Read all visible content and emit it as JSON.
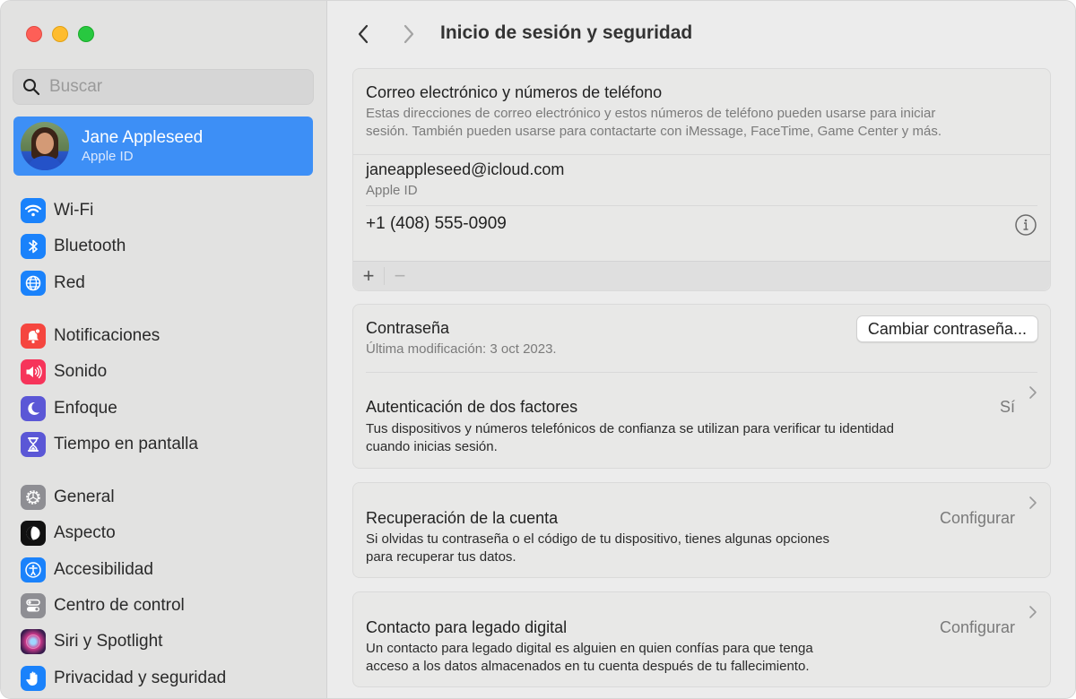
{
  "window": {
    "traffic_lights": [
      "close",
      "minimize",
      "zoom"
    ]
  },
  "sidebar": {
    "search": {
      "placeholder": "Buscar",
      "value": ""
    },
    "account": {
      "name": "Jane Appleseed",
      "subtitle": "Apple ID",
      "selected": true
    },
    "groups": [
      [
        {
          "label": "Wi-Fi",
          "icon": "wifi-icon",
          "color": "#1a82fb"
        },
        {
          "label": "Bluetooth",
          "icon": "bluetooth-icon",
          "color": "#1a82fb"
        },
        {
          "label": "Red",
          "icon": "globe-icon",
          "color": "#1a82fb"
        }
      ],
      [
        {
          "label": "Notificaciones",
          "icon": "bell-icon",
          "color": "#f5463f"
        },
        {
          "label": "Sonido",
          "icon": "speaker-icon",
          "color": "#f6345a"
        },
        {
          "label": "Enfoque",
          "icon": "moon-icon",
          "color": "#5b57d6"
        },
        {
          "label": "Tiempo en pantalla",
          "icon": "hourglass-icon",
          "color": "#5b57d6"
        }
      ],
      [
        {
          "label": "General",
          "icon": "gear-icon",
          "color": "#8e8e93"
        },
        {
          "label": "Aspecto",
          "icon": "appearance-icon",
          "color": "#111111"
        },
        {
          "label": "Accesibilidad",
          "icon": "accessibility-icon",
          "color": "#1a82fb"
        },
        {
          "label": "Centro de control",
          "icon": "toggles-icon",
          "color": "#8e8e93"
        },
        {
          "label": "Siri y Spotlight",
          "icon": "siri-icon",
          "color": "#3a1d4e"
        },
        {
          "label": "Privacidad y seguridad",
          "icon": "hand-icon",
          "color": "#1a82fb"
        }
      ]
    ]
  },
  "main": {
    "title": "Inicio de sesión y seguridad",
    "email_section": {
      "title": "Correo electrónico y números de teléfono",
      "description_line1": "Estas direcciones de correo electrónico y estos números de teléfono pueden usarse para iniciar",
      "description_line2": "sesión. También pueden usarse para contactarte con iMessage, FaceTime, Game Center y más.",
      "entries": [
        {
          "value": "janeappleseed@icloud.com",
          "label": "Apple ID"
        },
        {
          "value": "+1 (408) 555-0909",
          "label": ""
        }
      ],
      "add_label": "+",
      "remove_label": "−"
    },
    "password_section": {
      "title": "Contraseña",
      "subtitle": "Última modificación: 3 oct 2023.",
      "button": "Cambiar contraseña..."
    },
    "two_factor": {
      "title": "Autenticación de dos factores",
      "value": "Sí",
      "description_line1": "Tus dispositivos y números telefónicos de confianza se utilizan para verificar tu identidad",
      "description_line2": "cuando inicias sesión."
    },
    "account_recovery": {
      "title": "Recuperación de la cuenta",
      "value": "Configurar",
      "description_line1": "Si olvidas tu contraseña o el código de tu dispositivo, tienes algunas opciones",
      "description_line2": "para recuperar tus datos."
    },
    "legacy_contact": {
      "title": "Contacto para legado digital",
      "value": "Configurar",
      "description_line1": "Un contacto para legado digital es alguien en quien confías para que tenga",
      "description_line2": "acceso a los datos almacenados en tu cuenta después de tu fallecimiento."
    }
  },
  "colors": {
    "accent": "#3d8ff6",
    "sidebar_bg": "#e2e2e1",
    "main_bg": "#ececec",
    "card_bg": "#e8e8e7"
  }
}
